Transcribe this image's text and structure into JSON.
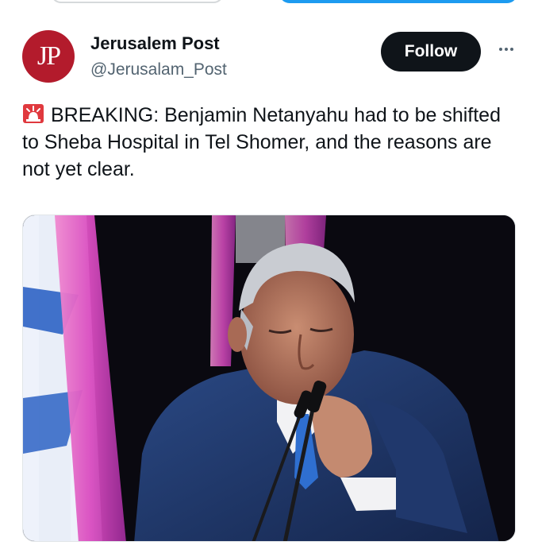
{
  "account": {
    "name": "Jerusalem Post",
    "handle": "@Jerusalam_Post",
    "avatar_text": "JP",
    "avatar_color": "#b31b2c"
  },
  "actions": {
    "follow_label": "Follow",
    "more_icon": "more-horizontal-icon"
  },
  "tweet": {
    "emoji_icon": "rotating-light-icon",
    "text": "BREAKING: Benjamin Netanyahu had to be shifted to Sheba Hospital in Tel Shomer, and the reasons are not yet clear."
  },
  "colors": {
    "text_primary": "#0f1419",
    "text_secondary": "#536471",
    "follow_bg": "#0f1419",
    "accent_blue": "#1d9bf0"
  }
}
